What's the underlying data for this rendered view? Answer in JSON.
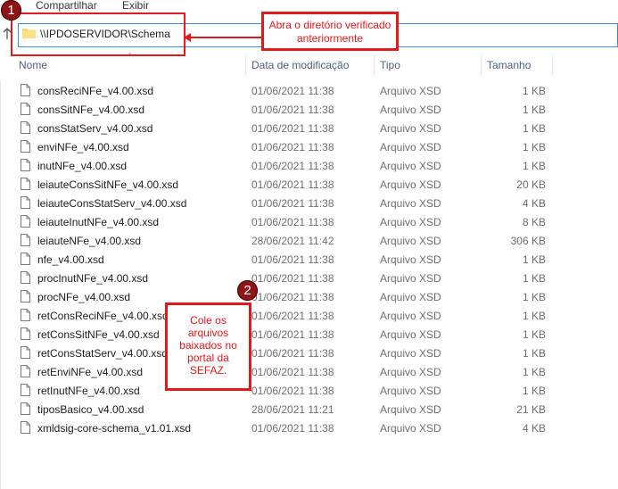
{
  "menu": {
    "share": "Compartilhar",
    "view": "Exibir"
  },
  "address": {
    "path": "\\\\IPDOSERVIDOR\\Schema"
  },
  "annotations": {
    "marker1": "1",
    "marker2": "2",
    "note1": "Abra o diretório verificado anteriormente",
    "note2": "Cole os arquivos baixados no portal da SEFAZ.",
    "accent_color": "#e0191c"
  },
  "columns": {
    "name": "Nome",
    "modified": "Data de modificação",
    "type": "Tipo",
    "size": "Tamanho"
  },
  "files": [
    {
      "name": "consReciNFe_v4.00.xsd",
      "modified": "01/06/2021 11:38",
      "type": "Arquivo XSD",
      "size": "1 KB"
    },
    {
      "name": "consSitNFe_v4.00.xsd",
      "modified": "01/06/2021 11:38",
      "type": "Arquivo XSD",
      "size": "1 KB"
    },
    {
      "name": "consStatServ_v4.00.xsd",
      "modified": "01/06/2021 11:38",
      "type": "Arquivo XSD",
      "size": "1 KB"
    },
    {
      "name": "enviNFe_v4.00.xsd",
      "modified": "01/06/2021 11:38",
      "type": "Arquivo XSD",
      "size": "1 KB"
    },
    {
      "name": "inutNFe_v4.00.xsd",
      "modified": "01/06/2021 11:38",
      "type": "Arquivo XSD",
      "size": "1 KB"
    },
    {
      "name": "leiauteConsSitNFe_v4.00.xsd",
      "modified": "01/06/2021 11:38",
      "type": "Arquivo XSD",
      "size": "20 KB"
    },
    {
      "name": "leiauteConsStatServ_v4.00.xsd",
      "modified": "01/06/2021 11:38",
      "type": "Arquivo XSD",
      "size": "4 KB"
    },
    {
      "name": "leiauteInutNFe_v4.00.xsd",
      "modified": "01/06/2021 11:38",
      "type": "Arquivo XSD",
      "size": "8 KB"
    },
    {
      "name": "leiauteNFe_v4.00.xsd",
      "modified": "28/06/2021 11:42",
      "type": "Arquivo XSD",
      "size": "306 KB"
    },
    {
      "name": "nfe_v4.00.xsd",
      "modified": "01/06/2021 11:38",
      "type": "Arquivo XSD",
      "size": "1 KB"
    },
    {
      "name": "procInutNFe_v4.00.xsd",
      "modified": "01/06/2021 11:38",
      "type": "Arquivo XSD",
      "size": "1 KB"
    },
    {
      "name": "procNFe_v4.00.xsd",
      "modified": "01/06/2021 11:38",
      "type": "Arquivo XSD",
      "size": "1 KB"
    },
    {
      "name": "retConsReciNFe_v4.00.xsd",
      "modified": "01/06/2021 11:38",
      "type": "Arquivo XSD",
      "size": "1 KB"
    },
    {
      "name": "retConsSitNFe_v4.00.xsd",
      "modified": "01/06/2021 11:38",
      "type": "Arquivo XSD",
      "size": "1 KB"
    },
    {
      "name": "retConsStatServ_v4.00.xsd",
      "modified": "01/06/2021 11:38",
      "type": "Arquivo XSD",
      "size": "1 KB"
    },
    {
      "name": "retEnviNFe_v4.00.xsd",
      "modified": "01/06/2021 11:38",
      "type": "Arquivo XSD",
      "size": "1 KB"
    },
    {
      "name": "retInutNFe_v4.00.xsd",
      "modified": "01/06/2021 11:38",
      "type": "Arquivo XSD",
      "size": "1 KB"
    },
    {
      "name": "tiposBasico_v4.00.xsd",
      "modified": "28/06/2021 11:21",
      "type": "Arquivo XSD",
      "size": "21 KB"
    },
    {
      "name": "xmldsig-core-schema_v1.01.xsd",
      "modified": "01/06/2021 11:38",
      "type": "Arquivo XSD",
      "size": "4 KB"
    }
  ]
}
